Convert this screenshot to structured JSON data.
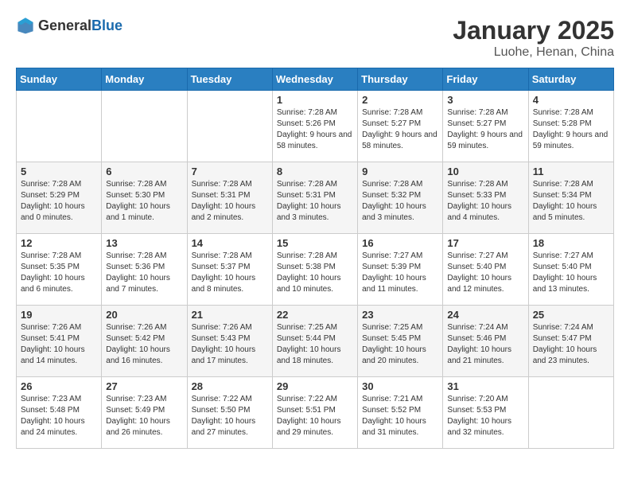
{
  "header": {
    "logo": {
      "general": "General",
      "blue": "Blue"
    },
    "title": "January 2025",
    "subtitle": "Luohe, Henan, China"
  },
  "weekdays": [
    "Sunday",
    "Monday",
    "Tuesday",
    "Wednesday",
    "Thursday",
    "Friday",
    "Saturday"
  ],
  "weeks": [
    [
      null,
      null,
      null,
      {
        "day": "1",
        "sunrise": "7:28 AM",
        "sunset": "5:26 PM",
        "daylight": "9 hours and 58 minutes."
      },
      {
        "day": "2",
        "sunrise": "7:28 AM",
        "sunset": "5:27 PM",
        "daylight": "9 hours and 58 minutes."
      },
      {
        "day": "3",
        "sunrise": "7:28 AM",
        "sunset": "5:27 PM",
        "daylight": "9 hours and 59 minutes."
      },
      {
        "day": "4",
        "sunrise": "7:28 AM",
        "sunset": "5:28 PM",
        "daylight": "9 hours and 59 minutes."
      }
    ],
    [
      {
        "day": "5",
        "sunrise": "7:28 AM",
        "sunset": "5:29 PM",
        "daylight": "10 hours and 0 minutes."
      },
      {
        "day": "6",
        "sunrise": "7:28 AM",
        "sunset": "5:30 PM",
        "daylight": "10 hours and 1 minute."
      },
      {
        "day": "7",
        "sunrise": "7:28 AM",
        "sunset": "5:31 PM",
        "daylight": "10 hours and 2 minutes."
      },
      {
        "day": "8",
        "sunrise": "7:28 AM",
        "sunset": "5:31 PM",
        "daylight": "10 hours and 3 minutes."
      },
      {
        "day": "9",
        "sunrise": "7:28 AM",
        "sunset": "5:32 PM",
        "daylight": "10 hours and 3 minutes."
      },
      {
        "day": "10",
        "sunrise": "7:28 AM",
        "sunset": "5:33 PM",
        "daylight": "10 hours and 4 minutes."
      },
      {
        "day": "11",
        "sunrise": "7:28 AM",
        "sunset": "5:34 PM",
        "daylight": "10 hours and 5 minutes."
      }
    ],
    [
      {
        "day": "12",
        "sunrise": "7:28 AM",
        "sunset": "5:35 PM",
        "daylight": "10 hours and 6 minutes."
      },
      {
        "day": "13",
        "sunrise": "7:28 AM",
        "sunset": "5:36 PM",
        "daylight": "10 hours and 7 minutes."
      },
      {
        "day": "14",
        "sunrise": "7:28 AM",
        "sunset": "5:37 PM",
        "daylight": "10 hours and 8 minutes."
      },
      {
        "day": "15",
        "sunrise": "7:28 AM",
        "sunset": "5:38 PM",
        "daylight": "10 hours and 10 minutes."
      },
      {
        "day": "16",
        "sunrise": "7:27 AM",
        "sunset": "5:39 PM",
        "daylight": "10 hours and 11 minutes."
      },
      {
        "day": "17",
        "sunrise": "7:27 AM",
        "sunset": "5:40 PM",
        "daylight": "10 hours and 12 minutes."
      },
      {
        "day": "18",
        "sunrise": "7:27 AM",
        "sunset": "5:40 PM",
        "daylight": "10 hours and 13 minutes."
      }
    ],
    [
      {
        "day": "19",
        "sunrise": "7:26 AM",
        "sunset": "5:41 PM",
        "daylight": "10 hours and 14 minutes."
      },
      {
        "day": "20",
        "sunrise": "7:26 AM",
        "sunset": "5:42 PM",
        "daylight": "10 hours and 16 minutes."
      },
      {
        "day": "21",
        "sunrise": "7:26 AM",
        "sunset": "5:43 PM",
        "daylight": "10 hours and 17 minutes."
      },
      {
        "day": "22",
        "sunrise": "7:25 AM",
        "sunset": "5:44 PM",
        "daylight": "10 hours and 18 minutes."
      },
      {
        "day": "23",
        "sunrise": "7:25 AM",
        "sunset": "5:45 PM",
        "daylight": "10 hours and 20 minutes."
      },
      {
        "day": "24",
        "sunrise": "7:24 AM",
        "sunset": "5:46 PM",
        "daylight": "10 hours and 21 minutes."
      },
      {
        "day": "25",
        "sunrise": "7:24 AM",
        "sunset": "5:47 PM",
        "daylight": "10 hours and 23 minutes."
      }
    ],
    [
      {
        "day": "26",
        "sunrise": "7:23 AM",
        "sunset": "5:48 PM",
        "daylight": "10 hours and 24 minutes."
      },
      {
        "day": "27",
        "sunrise": "7:23 AM",
        "sunset": "5:49 PM",
        "daylight": "10 hours and 26 minutes."
      },
      {
        "day": "28",
        "sunrise": "7:22 AM",
        "sunset": "5:50 PM",
        "daylight": "10 hours and 27 minutes."
      },
      {
        "day": "29",
        "sunrise": "7:22 AM",
        "sunset": "5:51 PM",
        "daylight": "10 hours and 29 minutes."
      },
      {
        "day": "30",
        "sunrise": "7:21 AM",
        "sunset": "5:52 PM",
        "daylight": "10 hours and 31 minutes."
      },
      {
        "day": "31",
        "sunrise": "7:20 AM",
        "sunset": "5:53 PM",
        "daylight": "10 hours and 32 minutes."
      },
      null
    ]
  ],
  "labels": {
    "sunrise": "Sunrise:",
    "sunset": "Sunset:",
    "daylight": "Daylight:"
  }
}
